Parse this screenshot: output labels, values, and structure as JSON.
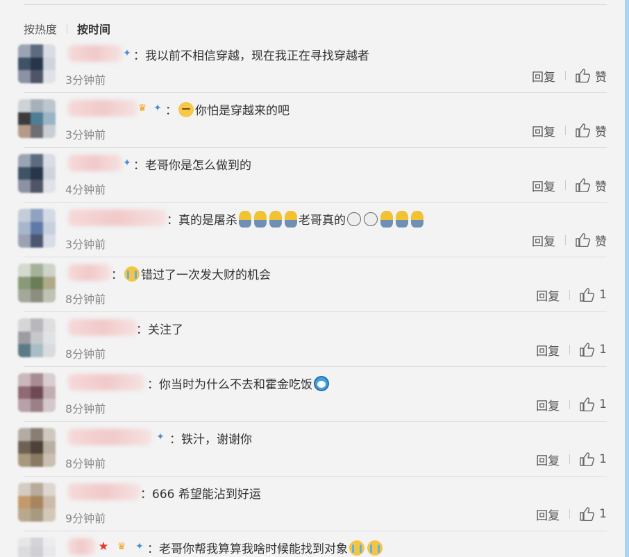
{
  "sort": {
    "hot_label": "按热度",
    "time_label": "按时间"
  },
  "comments": [
    {
      "text": "：我以前不相信穿越，现在我正在寻找穿越者",
      "time": "3分钟前",
      "reply": "回复",
      "like": "赞"
    },
    {
      "text_after": "你怕是穿越来的吧",
      "time": "3分钟前",
      "reply": "回复",
      "like": "赞"
    },
    {
      "text": "：老哥你是怎么做到的",
      "time": "4分钟前",
      "reply": "回复",
      "like": "赞"
    },
    {
      "text_a": "：真的是屠杀",
      "text_b": " 老哥真的",
      "time": "3分钟前",
      "reply": "回复",
      "like": "赞"
    },
    {
      "text_after": "错过了一次发大财的机会",
      "time": "8分钟前",
      "reply": "回复",
      "like": "1"
    },
    {
      "text": "：关注了",
      "time": "8分钟前",
      "reply": "回复",
      "like": "1"
    },
    {
      "text": "：你当时为什么不去和霍金吃饭",
      "time": "8分钟前",
      "reply": "回复",
      "like": "1"
    },
    {
      "text": "：铁汁，谢谢你",
      "time": "8分钟前",
      "reply": "回复",
      "like": "1"
    },
    {
      "text": "：666 希望能沾到好运",
      "time": "9分钟前",
      "reply": "回复",
      "like": "1"
    },
    {
      "text": "：老哥你帮我算算我啥时候能找到对象",
      "time": "",
      "reply": "",
      "like": ""
    }
  ],
  "colors": {
    "accent_edge": "#a9d5f3",
    "background": "#f3f3f3",
    "text": "#333333",
    "muted": "#888888"
  },
  "icons": [
    "like-thumb-icon",
    "vip-shield-icon",
    "star-badge-icon",
    "crown-badge-icon",
    "emoji-sleepy-icon",
    "emoji-cry-icon",
    "emoji-figure-icon",
    "emoji-doraemon-icon"
  ]
}
